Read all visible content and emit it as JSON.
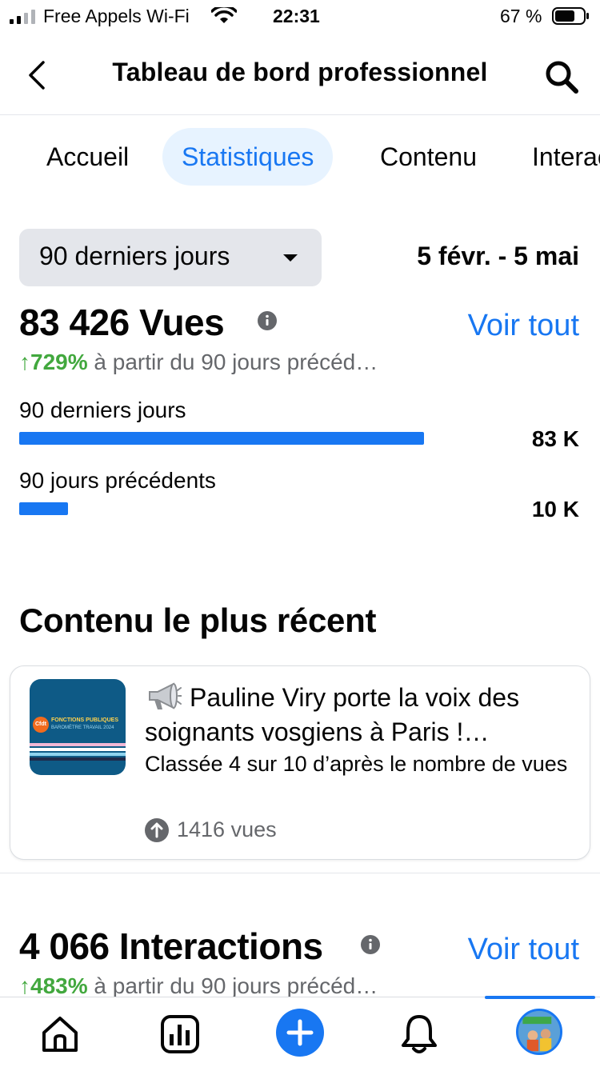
{
  "status_bar": {
    "carrier": "Free Appels Wi-Fi",
    "time": "22:31",
    "battery_percent": "67 %",
    "icons": [
      "signal-icon",
      "wifi-icon",
      "battery-icon"
    ]
  },
  "header": {
    "title": "Tableau de bord professionnel",
    "icons": [
      "back-chevron-icon",
      "search-icon"
    ]
  },
  "tabs": [
    {
      "label": "Accueil",
      "active": false
    },
    {
      "label": "Statistiques",
      "active": true
    },
    {
      "label": "Contenu",
      "active": false
    },
    {
      "label": "Interactions",
      "active": false
    }
  ],
  "filters": {
    "range_label": "90 derniers jours",
    "date_range": "5 févr. - 5 mai"
  },
  "views": {
    "title": "83 426 Vues",
    "see_all": "Voir tout",
    "delta_pct": "↑729%",
    "delta_text": " à partir du 90 jours précéd…",
    "bars": [
      {
        "label": "90 derniers jours",
        "value": "83 K",
        "fraction": 1.0
      },
      {
        "label": "90 jours précédents",
        "value": "10 K",
        "fraction": 0.12
      }
    ]
  },
  "recent_content": {
    "section_title": "Contenu le plus récent",
    "post": {
      "thumbnail_text": [
        "Cfdt",
        "FONCTIONS PUBLIQUES",
        "BAROMÈTRE TRAVAIL 2024"
      ],
      "title": "Pauline Viry porte la voix des soignants vosgiens à Paris !…",
      "rank": "Classée 4 sur 10 d’après le nombre de vues",
      "views": "1416 vues",
      "icons": [
        "megaphone-icon",
        "arrow-up-circle-icon"
      ]
    }
  },
  "interactions": {
    "title": "4 066 Interactions",
    "see_all": "Voir tout",
    "delta_pct": "↑483%",
    "delta_text": " à partir du 90 jours précéd…"
  },
  "bottom_nav": {
    "items": [
      "home-icon",
      "insights-icon",
      "create-plus-icon",
      "notifications-bell-icon",
      "profile-avatar"
    ]
  },
  "colors": {
    "accent": "#1877f2",
    "positive": "#42a83e",
    "secondary_text": "#65676b",
    "tab_active_bg": "#e7f3ff"
  }
}
